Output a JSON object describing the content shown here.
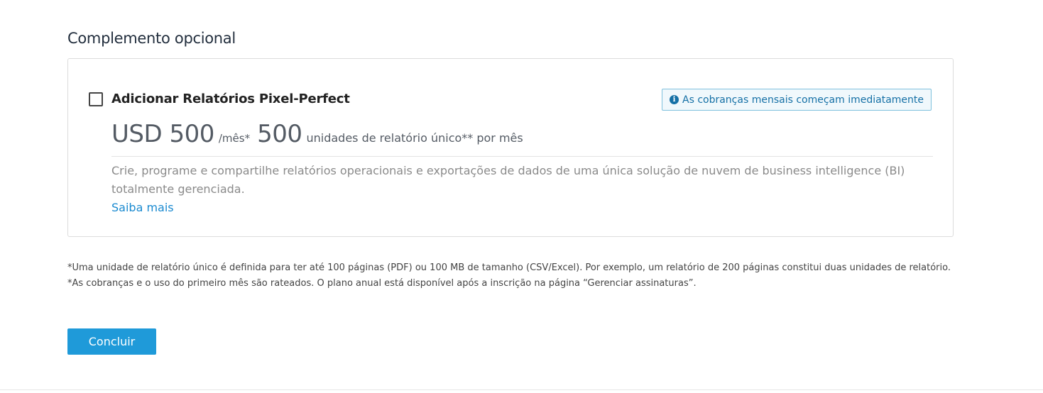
{
  "section": {
    "title": "Complemento opcional"
  },
  "addon": {
    "checked": false,
    "title": "Adicionar Relatórios Pixel-Perfect",
    "notice": "As cobranças mensais começam imediatamente",
    "notice_icon": "info-icon",
    "price": "USD 500",
    "price_unit": "/mês*",
    "units": "500",
    "units_text": "unidades de relatório único** por mês",
    "description": "Crie, programe e compartilhe relatórios operacionais e exportações de dados de uma única solução de nuvem de business intelligence (BI) totalmente gerenciada.",
    "learn_more": "Saiba mais"
  },
  "footnotes": {
    "line1": "*Uma unidade de relatório único é definida para ter até 100 páginas (PDF) ou 100 MB de tamanho (CSV/Excel). Por exemplo, um relatório de 200 páginas constitui duas unidades de relatório.",
    "line2": "*As cobranças e o uso do primeiro mês são rateados. O plano anual está disponível após a inscrição na página “Gerenciar assinaturas”."
  },
  "actions": {
    "done_label": "Concluir"
  },
  "colors": {
    "accent": "#1f9ad9",
    "link": "#1a8ad0",
    "notice_border": "#7fc1dd",
    "notice_bg": "#f0f8fc"
  }
}
